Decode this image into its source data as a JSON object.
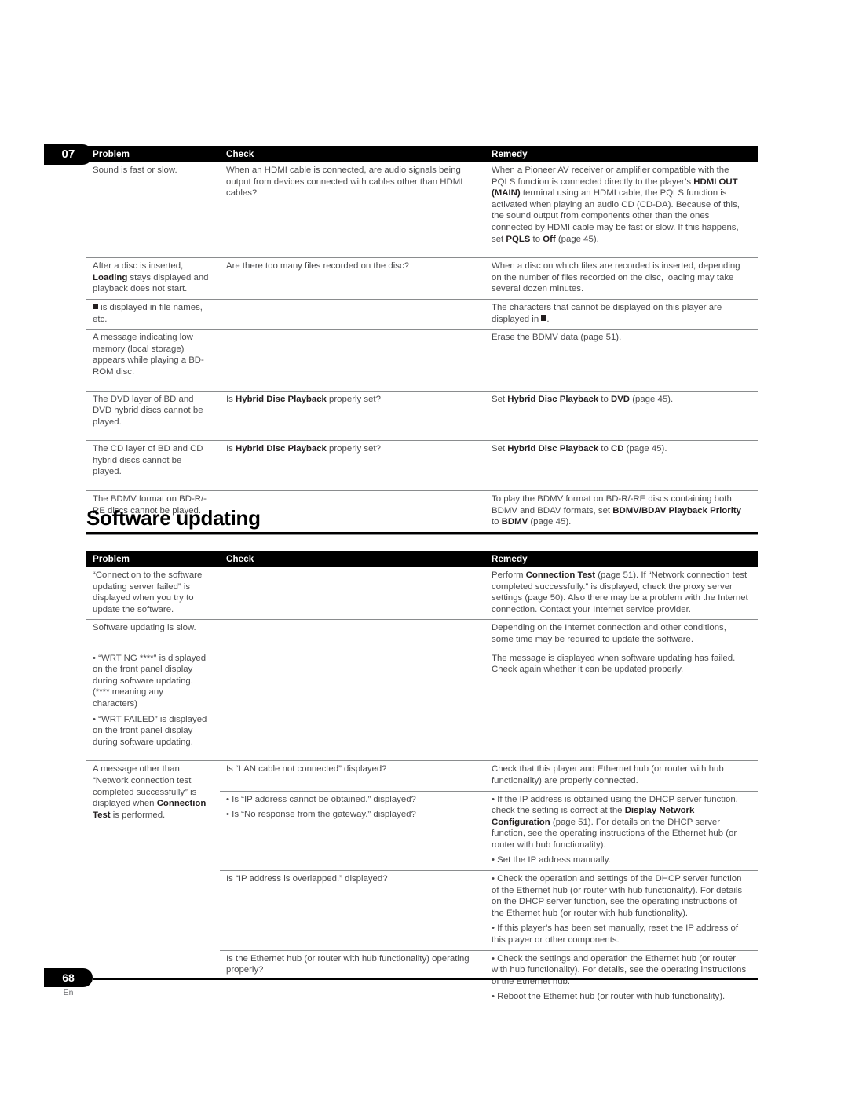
{
  "page": {
    "chapter_number": "07",
    "folio_number": "68",
    "folio_language": "En"
  },
  "table_troubleshooting": {
    "headers": {
      "problem": "Problem",
      "check": "Check",
      "remedy": "Remedy"
    },
    "rows": [
      {
        "problem_plain": "Sound is fast or slow.",
        "check": "When an HDMI cable is connected, are audio signals being output from devices connected with cables other than HDMI cables?",
        "remedy_parts": [
          {
            "t": "When a Pioneer AV receiver or amplifier compatible with the PQLS function is connected directly to the player’s ",
            "b": false
          },
          {
            "t": "HDMI OUT (MAIN)",
            "b": true
          },
          {
            "t": " terminal using an HDMI cable, the PQLS function is activated when playing an audio CD (CD-DA). Because of this, the sound output from components other than the ones connected by HDMI cable may be fast or slow. If this happens, set ",
            "b": false
          },
          {
            "t": "PQLS",
            "b": true
          },
          {
            "t": " to ",
            "b": false
          },
          {
            "t": "Off",
            "b": true
          },
          {
            "t": " (page 45).",
            "b": false
          }
        ]
      },
      {
        "problem_parts": [
          {
            "t": "After a disc is inserted, ",
            "b": false
          },
          {
            "t": "Loading",
            "b": true
          },
          {
            "t": " stays displayed and playback does not start.",
            "b": false
          }
        ],
        "check": "Are there too many files recorded on the disc?",
        "remedy": "When a disc on which files are recorded is inserted, depending on the number of files recorded on the disc, loading may take several dozen minutes."
      },
      {
        "problem_prefix_square": true,
        "problem_plain": " is displayed in file names, etc.",
        "check": "",
        "remedy_suffix_square": true,
        "remedy_plain": "The characters that cannot be displayed on this player are displayed in "
      },
      {
        "problem_plain": "A message indicating low memory (local storage) appears while playing a BD-ROM disc.",
        "check": "",
        "remedy_plain": "Erase the BDMV data (page 51)."
      },
      {
        "problem_plain": "The DVD layer of BD and DVD hybrid discs cannot be played.",
        "check_parts": [
          {
            "t": "Is ",
            "b": false
          },
          {
            "t": "Hybrid Disc Playback",
            "b": true
          },
          {
            "t": " properly set?",
            "b": false
          }
        ],
        "remedy_parts": [
          {
            "t": "Set ",
            "b": false
          },
          {
            "t": "Hybrid Disc Playback",
            "b": true
          },
          {
            "t": " to ",
            "b": false
          },
          {
            "t": "DVD",
            "b": true
          },
          {
            "t": " (page 45).",
            "b": false
          }
        ]
      },
      {
        "problem_plain": "The CD layer of BD and CD hybrid discs cannot be played.",
        "check_parts": [
          {
            "t": "Is ",
            "b": false
          },
          {
            "t": "Hybrid Disc Playback",
            "b": true
          },
          {
            "t": " properly set?",
            "b": false
          }
        ],
        "remedy_parts": [
          {
            "t": "Set ",
            "b": false
          },
          {
            "t": "Hybrid Disc Playback",
            "b": true
          },
          {
            "t": " to ",
            "b": false
          },
          {
            "t": "CD",
            "b": true
          },
          {
            "t": " (page 45).",
            "b": false
          }
        ]
      },
      {
        "problem_plain": "The BDMV format on BD-R/-RE discs cannot be played.",
        "check": "",
        "remedy_parts": [
          {
            "t": "To play the BDMV format on BD-R/-RE discs containing both BDMV and BDAV formats, set ",
            "b": false
          },
          {
            "t": "BDMV/BDAV Playback Priority",
            "b": true
          },
          {
            "t": " to ",
            "b": false
          },
          {
            "t": "BDMV",
            "b": true
          },
          {
            "t": " (page 45).",
            "b": false
          }
        ]
      }
    ]
  },
  "section_software_updating": {
    "title": "Software updating",
    "headers": {
      "problem": "Problem",
      "check": "Check",
      "remedy": "Remedy"
    },
    "rows": [
      {
        "problem_plain": "“Connection to the software updating server failed” is displayed when you try to update the software.",
        "check": "",
        "remedy_parts": [
          {
            "t": "Perform ",
            "b": false
          },
          {
            "t": "Connection Test",
            "b": true
          },
          {
            "t": " (page 51). If “Network connection test completed successfully.” is displayed, check the proxy server settings (page 50). Also there may be a problem with the Internet connection. Contact your Internet service provider.",
            "b": false
          }
        ]
      },
      {
        "problem_plain": "Software updating is slow.",
        "check": "",
        "remedy_plain": "Depending on the Internet connection and other conditions, some time may be required to update the software."
      },
      {
        "problem_bullets": [
          "“WRT NG ****” is displayed on the front panel display during software updating. (**** meaning any characters)",
          "“WRT FAILED” is displayed on the front panel display during software updating."
        ],
        "check": "",
        "remedy_plain": "The message is displayed when software updating has failed. Check again whether it can be updated properly."
      },
      {
        "problem_parts": [
          {
            "t": "A message other than “Network connection test completed successfully” is displayed when ",
            "b": false
          },
          {
            "t": "Connection Test",
            "b": true
          },
          {
            "t": " is performed.",
            "b": false
          }
        ],
        "subrows": [
          {
            "check_plain": "Is “LAN cable not connected” displayed?",
            "remedy_plain": "Check that this player and Ethernet hub (or router with hub functionality) are properly connected."
          },
          {
            "check_bullets": [
              "Is “IP address cannot be obtained.” displayed?",
              "Is “No response from the gateway.” displayed?"
            ],
            "remedy_bullet_parts": [
              [
                {
                  "t": "If the IP address is obtained using the DHCP server function, check the setting is correct at the ",
                  "b": false
                },
                {
                  "t": "Display Network Configuration",
                  "b": true
                },
                {
                  "t": " (page 51). For details on the DHCP server function, see the operating instructions of the Ethernet hub (or router with hub functionality).",
                  "b": false
                }
              ],
              [
                {
                  "t": "Set the IP address manually.",
                  "b": false
                }
              ]
            ]
          },
          {
            "check_plain": "Is “IP address is overlapped.” displayed?",
            "remedy_bullets": [
              "Check the operation and settings of the DHCP server function of the Ethernet hub (or router with hub functionality). For details on the DHCP server function, see the operating instructions of the Ethernet hub (or router with hub functionality).",
              "If this player’s has been set manually, reset the IP address of this player or other components."
            ]
          },
          {
            "check_plain": "Is the Ethernet hub (or router with hub functionality) operating properly?",
            "remedy_bullets": [
              "Check the settings and operation the Ethernet hub (or router with hub functionality). For details, see the operating instructions of the Ethernet hub.",
              "Reboot the Ethernet hub (or router with hub functionality)."
            ]
          }
        ]
      }
    ]
  }
}
